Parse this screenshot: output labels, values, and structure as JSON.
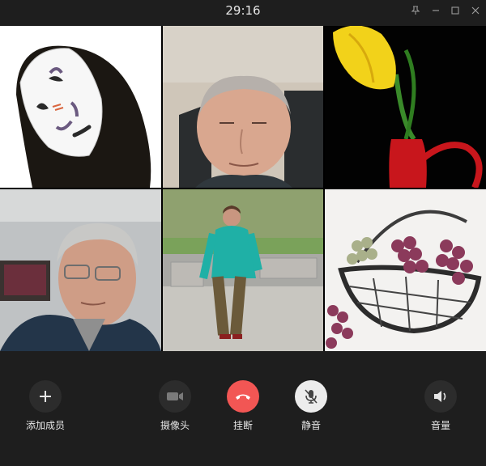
{
  "call": {
    "timer": "29:16"
  },
  "window_controls": [
    "pin-icon",
    "minimize-icon",
    "maximize-icon",
    "close-icon"
  ],
  "participants": [
    {
      "avatar": "no-face-spirit"
    },
    {
      "avatar": "elderly-man-selfie"
    },
    {
      "avatar": "yellow-tulip-red-vase"
    },
    {
      "avatar": "elderly-man-glasses"
    },
    {
      "avatar": "woman-walking-teal-jacket"
    },
    {
      "avatar": "grape-basket-painting"
    }
  ],
  "controls": {
    "add_member": {
      "label": "添加成员",
      "icon": "plus-icon"
    },
    "camera": {
      "label": "摄像头",
      "icon": "camera-icon",
      "state": "off"
    },
    "hangup": {
      "label": "挂断",
      "icon": "phone-hangup-icon",
      "color": "#f25654"
    },
    "mute": {
      "label": "静音",
      "icon": "mic-off-icon",
      "state": "on"
    },
    "volume": {
      "label": "音量",
      "icon": "speaker-icon"
    }
  }
}
